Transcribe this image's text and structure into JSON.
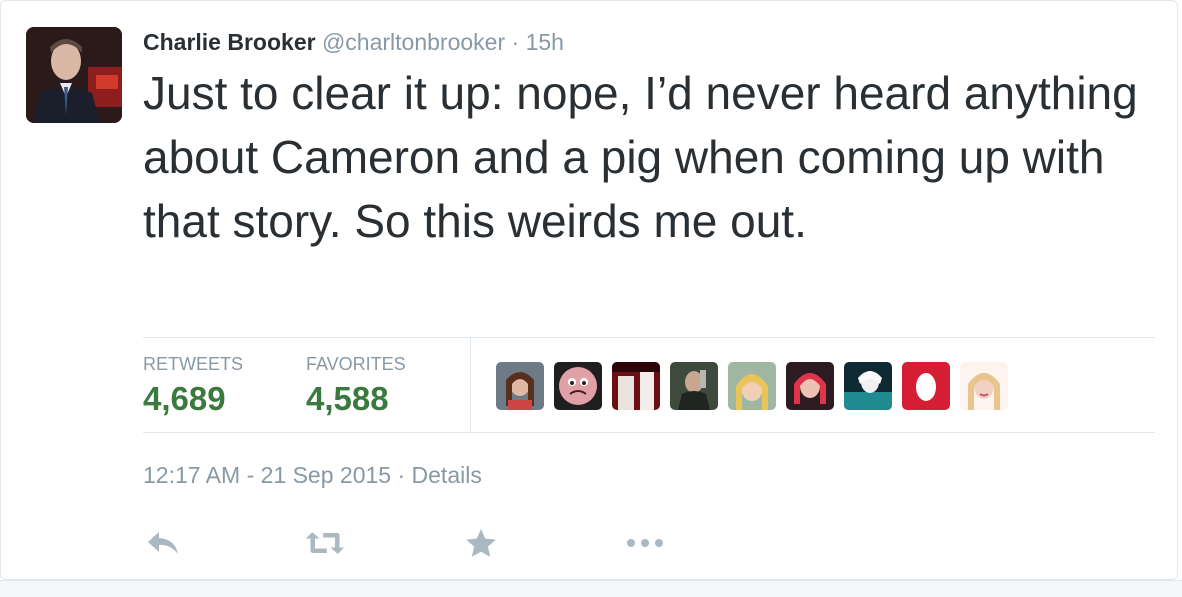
{
  "tweet": {
    "author_name": "Charlie Brooker",
    "author_handle": "@charltonbrooker",
    "separator": "·",
    "relative_time": "15h",
    "text": "Just to clear it up: nope, I’d never heard anything about Cameron and a pig when coming up with that story. So this weirds me out.",
    "timestamp": "12:17 AM - 21 Sep 2015",
    "details_separator": "·",
    "details_label": "Details"
  },
  "stats": {
    "retweets_label": "RETWEETS",
    "retweets_value": "4,689",
    "favorites_label": "FAVORITES",
    "favorites_value": "4,588"
  },
  "favoriters": [
    {
      "name": "favoriter-avatar-1"
    },
    {
      "name": "favoriter-avatar-2"
    },
    {
      "name": "favoriter-avatar-3"
    },
    {
      "name": "favoriter-avatar-4"
    },
    {
      "name": "favoriter-avatar-5"
    },
    {
      "name": "favoriter-avatar-6"
    },
    {
      "name": "favoriter-avatar-7"
    },
    {
      "name": "favoriter-avatar-8"
    },
    {
      "name": "favoriter-avatar-9"
    }
  ],
  "actions": [
    {
      "icon": "reply-icon"
    },
    {
      "icon": "retweet-icon"
    },
    {
      "icon": "favorite-star-icon"
    },
    {
      "icon": "more-options-icon"
    }
  ],
  "colors": {
    "text": "#292f33",
    "muted": "#8899a6",
    "stat_value": "#3b7a3f",
    "border": "#e1e8ed",
    "icon": "#aab8c2"
  }
}
